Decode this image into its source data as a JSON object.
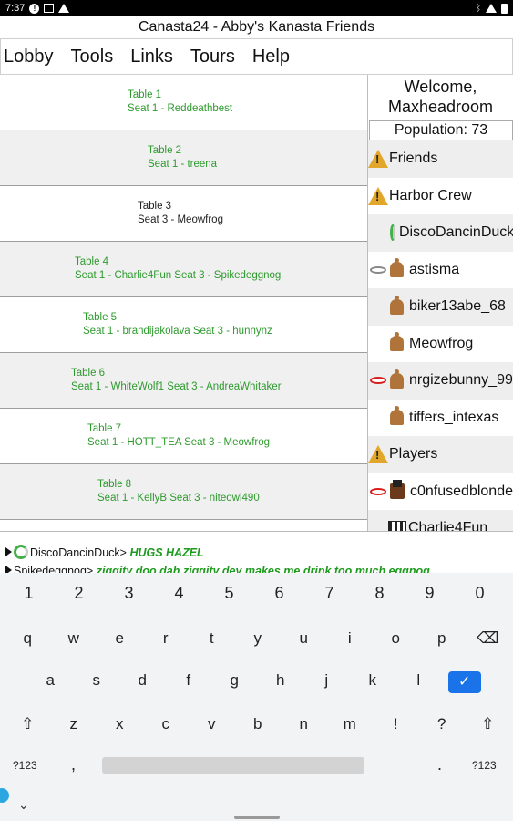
{
  "status_bar": {
    "time": "7:37"
  },
  "window_title": "Canasta24 - Abby's  Kanasta Friends",
  "menu": [
    "Lobby",
    "Tools",
    "Links",
    "Tours",
    "Help"
  ],
  "tables": [
    {
      "name": "Table 1",
      "seats": "Seat 1 - Reddeathbest",
      "color": "green",
      "offset": 140
    },
    {
      "name": "Table 2",
      "seats": "Seat 1 - treena",
      "color": "green",
      "offset": 162
    },
    {
      "name": "Table 3",
      "seats": "Seat 3 - Meowfrog",
      "color": "dark",
      "offset": 151
    },
    {
      "name": "Table 4",
      "seats": "Seat 1 - Charlie4Fun Seat 3 - Spikedeggnog",
      "color": "green",
      "offset": 82
    },
    {
      "name": "Table 5",
      "seats": "Seat 1 - brandijakolava Seat 3 - hunnynz",
      "color": "green",
      "offset": 91
    },
    {
      "name": "Table 6",
      "seats": "Seat 1 - WhiteWolf1 Seat 3 - AndreaWhitaker",
      "color": "green",
      "offset": 78
    },
    {
      "name": "Table 7",
      "seats": "Seat 1 - HOTT_TEA Seat 3 - Meowfrog",
      "color": "green",
      "offset": 96
    },
    {
      "name": "Table 8",
      "seats": "Seat 1 - KellyB Seat 3 - niteowl490",
      "color": "green",
      "offset": 107
    }
  ],
  "sidebar": {
    "welcome_line1": "Welcome,",
    "welcome_line2": "Maxheadroom",
    "population": "Population: 73",
    "rows": [
      {
        "label": "Friends",
        "kind": "group",
        "bg": "gray"
      },
      {
        "label": "Harbor Crew",
        "kind": "group",
        "bg": "white"
      },
      {
        "label": "DiscoDancinDuck",
        "kind": "ring",
        "bg": "gray"
      },
      {
        "label": "astisma",
        "kind": "bell-grayoval",
        "bg": "white"
      },
      {
        "label": "biker13abe_68",
        "kind": "bell",
        "bg": "gray"
      },
      {
        "label": "Meowfrog",
        "kind": "bell",
        "bg": "white"
      },
      {
        "label": "nrgizebunny_99",
        "kind": "bell-redoval",
        "bg": "gray"
      },
      {
        "label": "tiffers_intexas",
        "kind": "bell",
        "bg": "white"
      },
      {
        "label": "Players",
        "kind": "group",
        "bg": "gray"
      },
      {
        "label": "c0nfusedblonde",
        "kind": "pilgrim-redoval",
        "bg": "white"
      },
      {
        "label": "Charlie4Fun",
        "kind": "flag",
        "bg": "gray"
      }
    ]
  },
  "chat": [
    {
      "name": "DiscoDancinDuck>",
      "msg": "HUGS HAZEL"
    },
    {
      "name": "Spikedeggnog>",
      "msg": "ziggity doo dah ziggity dey makes me drink too much eggnog"
    }
  ],
  "keyboard": {
    "numbers": [
      "1",
      "2",
      "3",
      "4",
      "5",
      "6",
      "7",
      "8",
      "9",
      "0"
    ],
    "row1": [
      "q",
      "w",
      "e",
      "r",
      "t",
      "y",
      "u",
      "i",
      "o",
      "p"
    ],
    "row2": [
      "a",
      "s",
      "d",
      "f",
      "g",
      "h",
      "j",
      "k",
      "l"
    ],
    "row3": [
      "z",
      "x",
      "c",
      "v",
      "b",
      "n",
      "m",
      "!",
      "?"
    ],
    "symbols_label": "?123",
    "comma": ",",
    "period": "."
  }
}
